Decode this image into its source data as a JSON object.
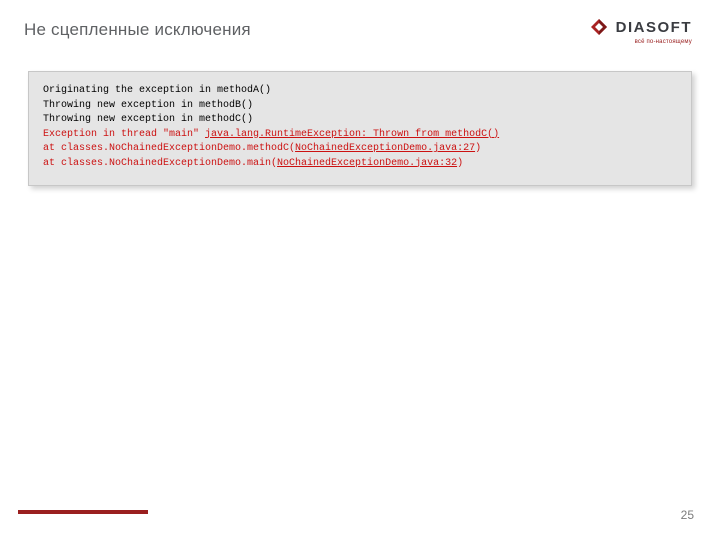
{
  "header": {
    "title": "Не сцепленные исключения"
  },
  "logo": {
    "name": "DIASOFT",
    "tagline": "всё по-настоящему"
  },
  "code": {
    "line1": "Originating the exception in methodA()",
    "line2": "Throwing new exception in methodB()",
    "line3": "Throwing new exception in methodC()",
    "line4_a": "Exception in thread \"main\" ",
    "line4_b": "java.lang.RuntimeException: Thrown from methodC()",
    "line5_a": "at classes.NoChainedExceptionDemo.methodC(",
    "line5_b": "NoChainedExceptionDemo.java:27",
    "line5_c": ")",
    "line6_a": "at classes.NoChainedExceptionDemo.main(",
    "line6_b": "NoChainedExceptionDemo.java:32",
    "line6_c": ")"
  },
  "footer": {
    "page": "25"
  }
}
